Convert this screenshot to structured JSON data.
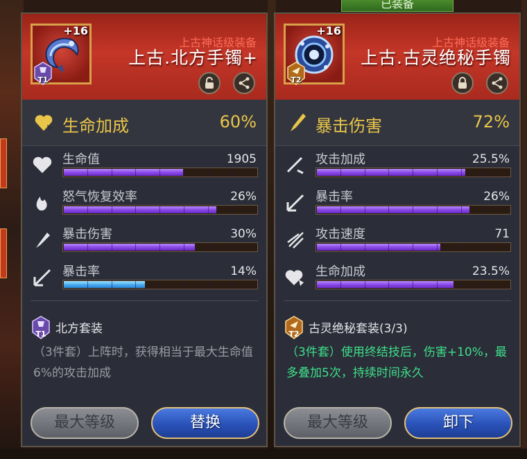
{
  "equipped_tag": "已装备",
  "left": {
    "level": "+16",
    "tier": "T1",
    "grade": "上古神话级装备",
    "name": "上古.北方手镯+",
    "main_stat": {
      "label": "生命加成",
      "value": "60%"
    },
    "stats": [
      {
        "label": "生命值",
        "value": "1905",
        "fill": 0.62,
        "color": "purple",
        "icon": "heart-icon"
      },
      {
        "label": "怒气恢复效率",
        "value": "26%",
        "fill": 0.79,
        "color": "purple",
        "icon": "rage-flame-icon"
      },
      {
        "label": "暴击伤害",
        "value": "30%",
        "fill": 0.68,
        "color": "purple",
        "icon": "crit-damage-icon"
      },
      {
        "label": "暴击率",
        "value": "14%",
        "fill": 0.42,
        "color": "blue",
        "icon": "crit-rate-icon"
      }
    ],
    "set": {
      "tier": "T1",
      "name": "北方套装",
      "desc": "（3件套）上阵时，获得相当于最大生命值6%的攻击加成",
      "active": false
    },
    "buttons": {
      "max_level": "最大等级",
      "action": "替换"
    }
  },
  "right": {
    "level": "+16",
    "tier": "T2",
    "grade": "上古神话级装备",
    "name": "上古.古灵绝秘手镯",
    "main_stat": {
      "label": "暴击伤害",
      "value": "72%"
    },
    "stats": [
      {
        "label": "攻击加成",
        "value": "25.5%",
        "fill": 0.77,
        "color": "purple",
        "icon": "attack-bonus-icon"
      },
      {
        "label": "暴击率",
        "value": "26%",
        "fill": 0.79,
        "color": "purple",
        "icon": "crit-rate-icon"
      },
      {
        "label": "攻击速度",
        "value": "71",
        "fill": 0.64,
        "color": "purple",
        "icon": "attack-speed-icon"
      },
      {
        "label": "生命加成",
        "value": "23.5%",
        "fill": 0.71,
        "color": "purple",
        "icon": "life-bonus-icon"
      }
    ],
    "set": {
      "tier": "T2",
      "name": "古灵绝秘套装(3/3)",
      "desc": "（3件套）使用终结技后，伤害+10%，最多叠加5次，持续时间永久",
      "active": true
    },
    "buttons": {
      "max_level": "最大等级",
      "action": "卸下"
    }
  }
}
